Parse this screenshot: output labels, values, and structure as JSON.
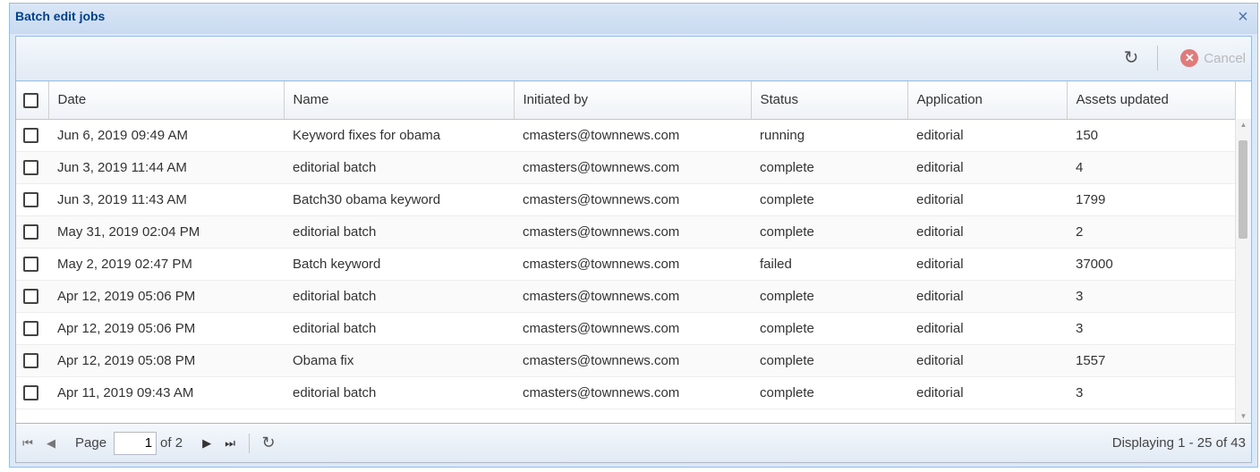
{
  "window": {
    "title": "Batch edit jobs",
    "close_glyph": "×"
  },
  "toolbar": {
    "refresh_icon": "↻",
    "cancel_label": "Cancel"
  },
  "columns": [
    "Date",
    "Name",
    "Initiated by",
    "Status",
    "Application",
    "Assets updated"
  ],
  "rows": [
    [
      "Jun 6, 2019 09:49 AM",
      "Keyword fixes for obama",
      "cmasters@townnews.com",
      "running",
      "editorial",
      "150"
    ],
    [
      "Jun 3, 2019 11:44 AM",
      "editorial batch",
      "cmasters@townnews.com",
      "complete",
      "editorial",
      "4"
    ],
    [
      "Jun 3, 2019 11:43 AM",
      "Batch30 obama keyword",
      "cmasters@townnews.com",
      "complete",
      "editorial",
      "1799"
    ],
    [
      "May 31, 2019 02:04 PM",
      "editorial batch",
      "cmasters@townnews.com",
      "complete",
      "editorial",
      "2"
    ],
    [
      "May 2, 2019 02:47 PM",
      "Batch keyword",
      "cmasters@townnews.com",
      "failed",
      "editorial",
      "37000"
    ],
    [
      "Apr 12, 2019 05:06 PM",
      "editorial batch",
      "cmasters@townnews.com",
      "complete",
      "editorial",
      "3"
    ],
    [
      "Apr 12, 2019 05:06 PM",
      "editorial batch",
      "cmasters@townnews.com",
      "complete",
      "editorial",
      "3"
    ],
    [
      "Apr 12, 2019 05:08 PM",
      "Obama fix",
      "cmasters@townnews.com",
      "complete",
      "editorial",
      "1557"
    ],
    [
      "Apr 11, 2019 09:43 AM",
      "editorial batch",
      "cmasters@townnews.com",
      "complete",
      "editorial",
      "3"
    ]
  ],
  "pager": {
    "first": "⏮",
    "prev": "◀",
    "page_label": "Page",
    "page_value": "1",
    "of_label": "of 2",
    "next": "▶",
    "last": "⏭",
    "refresh": "↻",
    "display_text": "Displaying 1 - 25 of 43"
  }
}
